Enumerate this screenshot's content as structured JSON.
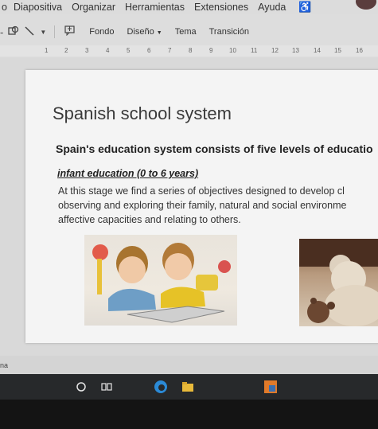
{
  "menu": {
    "items": [
      "o",
      "Diapositiva",
      "Organizar",
      "Herramientas",
      "Extensiones",
      "Ayuda"
    ]
  },
  "toolbar": {
    "background_label": "Fondo",
    "design_label": "Diseño",
    "theme_label": "Tema",
    "transition_label": "Transición"
  },
  "ruler": {
    "ticks": [
      "1",
      "2",
      "3",
      "4",
      "5",
      "6",
      "7",
      "8",
      "9",
      "10",
      "11",
      "12",
      "13",
      "14",
      "15",
      "16"
    ]
  },
  "slide": {
    "title": "Spanish school system",
    "subtitle": "Spain's education system consists of five levels of educatio",
    "section_heading": "infant education (0 to 6 years)",
    "body_lines": [
      "At this stage we find a series of objectives designed to develop cl",
      "observing and exploring their family, natural and social environme",
      "affective capacities and relating to others."
    ]
  },
  "status": {
    "text": "na"
  },
  "colors": {
    "menubar_bg": "#dcdcdc",
    "slide_bg": "#f4f4f4",
    "taskbar_bg": "#27292b",
    "edge_blue": "#2b8ad6",
    "app_orange": "#e07a2a"
  }
}
